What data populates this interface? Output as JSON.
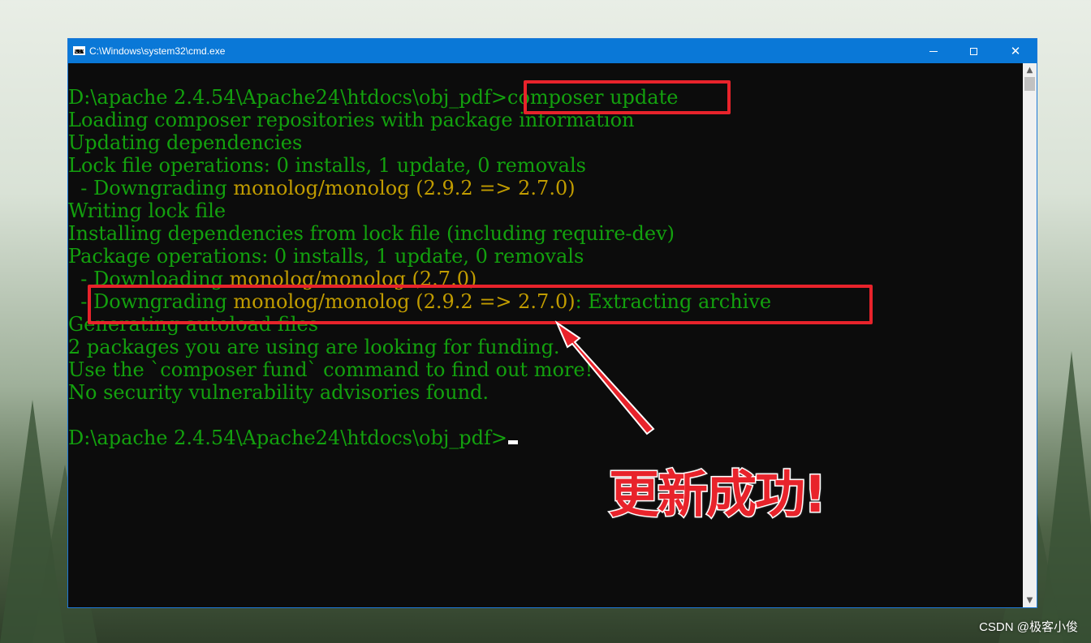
{
  "window": {
    "title": "C:\\Windows\\system32\\cmd.exe",
    "accent_color": "#0a78d7",
    "controls": {
      "minimize_icon": "minimize-icon",
      "maximize_icon": "maximize-icon",
      "close_icon": "close-icon",
      "close_glyph": "✕"
    }
  },
  "console": {
    "text_color": "#13a10e",
    "warn_color": "#c19c00",
    "lines": [
      {
        "prompt": "D:\\apache 2.4.54\\Apache24\\htdocs\\obj_pdf>",
        "cmd": "composer update"
      },
      {
        "text": "Loading composer repositories with package information"
      },
      {
        "text": "Updating dependencies"
      },
      {
        "text": "Lock file operations: 0 installs, 1 update, 0 removals"
      },
      {
        "pre": "  - Downgrading ",
        "pkg": "monolog/monolog",
        "ver": " (2.9.2 => 2.7.0)"
      },
      {
        "text": "Writing lock file"
      },
      {
        "text": "Installing dependencies from lock file (including require-dev)"
      },
      {
        "text": "Package operations: 0 installs, 1 update, 0 removals"
      },
      {
        "pre": "  - Downloading ",
        "pkg": "monolog/monolog",
        "ver": " (2.7.0)"
      },
      {
        "pre": "  - Downgrading ",
        "pkg": "monolog/monolog",
        "ver": " (2.9.2 => 2.7.0)",
        "post": ": Extracting archive"
      },
      {
        "text": "Generating autoload files"
      },
      {
        "text": "2 packages you are using are looking for funding."
      },
      {
        "text": "Use the `composer fund` command to find out more!"
      },
      {
        "text": "No security vulnerability advisories found."
      },
      {
        "prompt": "D:\\apache 2.4.54\\Apache24\\htdocs\\obj_pdf>"
      }
    ]
  },
  "scrollbar": {
    "up_glyph": "▲",
    "down_glyph": "▼"
  },
  "annotation": {
    "text": "更新成功!",
    "color": "#e8232b"
  },
  "watermark": "CSDN @极客小俊"
}
